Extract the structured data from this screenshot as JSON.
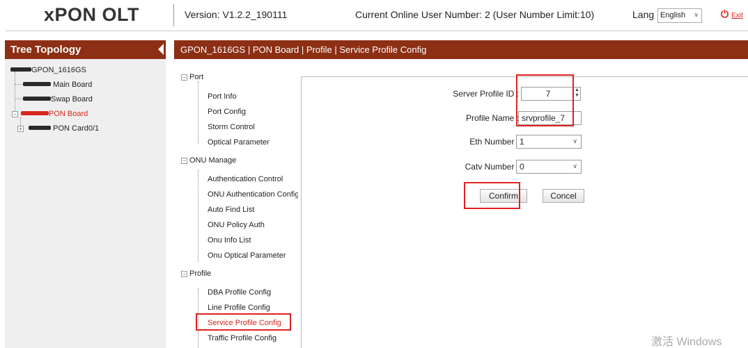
{
  "header": {
    "app_title": "xPON OLT",
    "version": "Version: V1.2.2_190111",
    "online_users": "Current Online User Number: 2 (User Number Limit:10)",
    "lang_label": "Lang",
    "lang_value": "English",
    "exit_icon": "power-icon",
    "exit_label": "Exit"
  },
  "tree": {
    "title": "Tree Topology",
    "nodes": [
      {
        "label": "GPON_1616GS"
      },
      {
        "label": "Main Board"
      },
      {
        "label": "Swap Board"
      },
      {
        "label": "PON Board"
      },
      {
        "label": "PON Card0/1"
      }
    ]
  },
  "breadcrumb": "GPON_1616GS | PON Board | Profile | Service Profile Config",
  "menu": {
    "groups": [
      {
        "label": "Port",
        "items": [
          "Port Info",
          "Port Config",
          "Storm Control",
          "Optical Parameter"
        ]
      },
      {
        "label": "ONU Manage",
        "items": [
          "Authentication Control",
          "ONU Authentication Config",
          "Auto Find List",
          "ONU Policy Auth",
          "Onu Info List",
          "Onu Optical Parameter"
        ]
      },
      {
        "label": "Profile",
        "items": [
          "DBA Profile Config",
          "Line Profile Config",
          "Service Profile Config",
          "Traffic Profile Config"
        ]
      }
    ],
    "active": "Service Profile Config"
  },
  "form": {
    "profile_id_label": "Server Profile ID :",
    "profile_id_value": "7",
    "profile_name_label": "Profile Name :",
    "profile_name_value": "srvprofile_7",
    "eth_label": "Eth Number :",
    "eth_value": "1",
    "catv_label": "Catv Number :",
    "catv_value": "0",
    "confirm_label": "Confirm",
    "cancel_label": "Concel"
  },
  "watermark": "激活 Windows",
  "colors": {
    "accent": "#8c2f14",
    "highlight": "#e02020",
    "active_text": "#d9261c"
  }
}
